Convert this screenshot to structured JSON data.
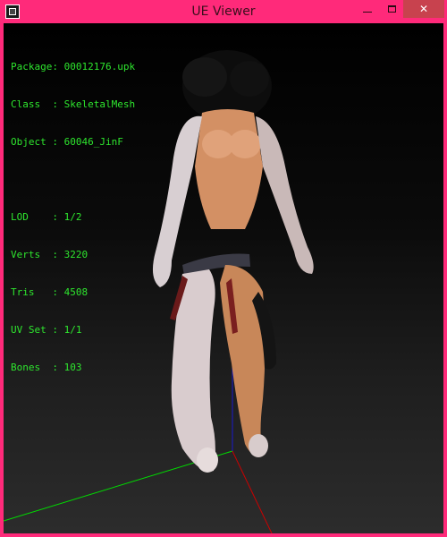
{
  "window": {
    "title": "UE Viewer",
    "icon": "app-icon",
    "controls": {
      "minimize": "minimize-icon",
      "maximize": "maximize-icon",
      "close": "close-icon"
    },
    "frame_color": "#ff2a7a"
  },
  "info": {
    "package": {
      "label": "Package:",
      "value": "00012176.upk"
    },
    "class": {
      "label": "Class  :",
      "value": "SkeletalMesh"
    },
    "object": {
      "label": "Object :",
      "value": "60046_JinF"
    },
    "lod": {
      "label": "LOD    :",
      "value": "1/2"
    },
    "verts": {
      "label": "Verts  :",
      "value": "3220"
    },
    "tris": {
      "label": "Tris   :",
      "value": "4508"
    },
    "uvset": {
      "label": "UV Set :",
      "value": "1/1"
    },
    "bones": {
      "label": "Bones  :",
      "value": "103"
    },
    "text_color": "#2ee62e"
  },
  "viewport": {
    "background": "#1e1e1e",
    "axes": {
      "x_color": "#ff0000",
      "y_color": "#00ff00",
      "z_color": "#0000ff"
    }
  }
}
